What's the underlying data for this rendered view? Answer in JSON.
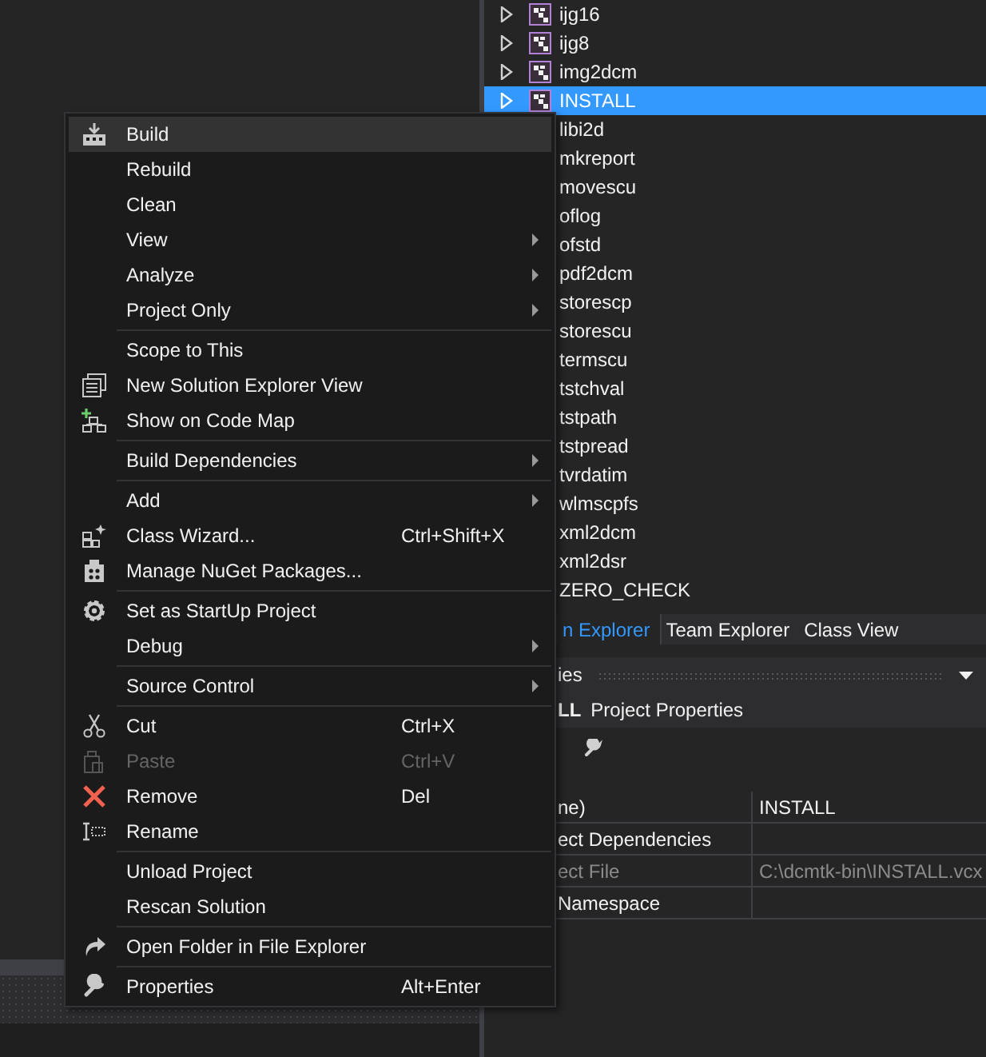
{
  "solution_explorer": {
    "items": [
      {
        "label": "ijg16",
        "selected": false
      },
      {
        "label": "ijg8",
        "selected": false
      },
      {
        "label": "img2dcm",
        "selected": false
      },
      {
        "label": "INSTALL",
        "selected": true
      },
      {
        "label": "libi2d",
        "selected": false
      },
      {
        "label": "mkreport",
        "selected": false
      },
      {
        "label": "movescu",
        "selected": false
      },
      {
        "label": "oflog",
        "selected": false
      },
      {
        "label": "ofstd",
        "selected": false
      },
      {
        "label": "pdf2dcm",
        "selected": false
      },
      {
        "label": "storescp",
        "selected": false
      },
      {
        "label": "storescu",
        "selected": false
      },
      {
        "label": "termscu",
        "selected": false
      },
      {
        "label": "tstchval",
        "selected": false
      },
      {
        "label": "tstpath",
        "selected": false
      },
      {
        "label": "tstpread",
        "selected": false
      },
      {
        "label": "tvrdatim",
        "selected": false
      },
      {
        "label": "wlmscpfs",
        "selected": false
      },
      {
        "label": "xml2dcm",
        "selected": false
      },
      {
        "label": "xml2dsr",
        "selected": false
      },
      {
        "label": "ZERO_CHECK",
        "selected": false
      }
    ]
  },
  "tabs": [
    {
      "label": "n Explorer",
      "selected": true
    },
    {
      "label": "Team Explorer",
      "selected": false
    },
    {
      "label": "Class View",
      "selected": false
    }
  ],
  "properties": {
    "title": "ies",
    "object": "LL",
    "object_type": "Project Properties",
    "rows": [
      {
        "name": "ne)",
        "value": "INSTALL",
        "disabled": false
      },
      {
        "name": "ect Dependencies",
        "disabled": false
      },
      {
        "name": "ect File",
        "value": "C:\\dcmtk-bin\\INSTALL.vcx",
        "disabled": true
      },
      {
        "name": "Namespace",
        "disabled": false
      }
    ]
  },
  "context_menu": {
    "items": [
      {
        "kind": "item",
        "label": "Build",
        "submenu": false,
        "disabled": false,
        "selected": true
      },
      {
        "kind": "item",
        "label": "Rebuild",
        "submenu": false,
        "disabled": false,
        "selected": false
      },
      {
        "kind": "item",
        "label": "Clean",
        "submenu": false,
        "disabled": false,
        "selected": false
      },
      {
        "kind": "item",
        "label": "View",
        "submenu": true,
        "disabled": false,
        "selected": false
      },
      {
        "kind": "item",
        "label": "Analyze",
        "submenu": true,
        "disabled": false,
        "selected": false
      },
      {
        "kind": "item",
        "label": "Project Only",
        "submenu": true,
        "disabled": false,
        "selected": false
      },
      {
        "kind": "separator"
      },
      {
        "kind": "item",
        "label": "Scope to This",
        "submenu": false,
        "disabled": false,
        "selected": false
      },
      {
        "kind": "item",
        "label": "New Solution Explorer View",
        "submenu": false,
        "disabled": false,
        "selected": false
      },
      {
        "kind": "item",
        "label": "Show on Code Map",
        "submenu": false,
        "disabled": false,
        "selected": false
      },
      {
        "kind": "separator"
      },
      {
        "kind": "item",
        "label": "Build Dependencies",
        "submenu": true,
        "disabled": false,
        "selected": false
      },
      {
        "kind": "separator"
      },
      {
        "kind": "item",
        "label": "Add",
        "submenu": true,
        "disabled": false,
        "selected": false
      },
      {
        "kind": "item",
        "label": "Class Wizard...",
        "shortcut": "Ctrl+Shift+X",
        "submenu": false,
        "disabled": false,
        "selected": false
      },
      {
        "kind": "item",
        "label": "Manage NuGet Packages...",
        "submenu": false,
        "disabled": false,
        "selected": false
      },
      {
        "kind": "separator"
      },
      {
        "kind": "item",
        "label": "Set as StartUp Project",
        "submenu": false,
        "disabled": false,
        "selected": false
      },
      {
        "kind": "item",
        "label": "Debug",
        "submenu": true,
        "disabled": false,
        "selected": false
      },
      {
        "kind": "separator"
      },
      {
        "kind": "item",
        "label": "Source Control",
        "submenu": true,
        "disabled": false,
        "selected": false
      },
      {
        "kind": "separator"
      },
      {
        "kind": "item",
        "label": "Cut",
        "shortcut": "Ctrl+X",
        "submenu": false,
        "disabled": false,
        "selected": false
      },
      {
        "kind": "item",
        "label": "Paste",
        "shortcut": "Ctrl+V",
        "submenu": false,
        "disabled": true,
        "selected": false
      },
      {
        "kind": "item",
        "label": "Remove",
        "shortcut": "Del",
        "submenu": false,
        "disabled": false,
        "selected": false
      },
      {
        "kind": "item",
        "label": "Rename",
        "submenu": false,
        "disabled": false,
        "selected": false
      },
      {
        "kind": "separator"
      },
      {
        "kind": "item",
        "label": "Unload Project",
        "submenu": false,
        "disabled": false,
        "selected": false
      },
      {
        "kind": "item",
        "label": "Rescan Solution",
        "submenu": false,
        "disabled": false,
        "selected": false
      },
      {
        "kind": "separator"
      },
      {
        "kind": "item",
        "label": "Open Folder in File Explorer",
        "submenu": false,
        "disabled": false,
        "selected": false
      },
      {
        "kind": "separator"
      },
      {
        "kind": "item",
        "label": "Properties",
        "shortcut": "Alt+Enter",
        "submenu": false,
        "disabled": false,
        "selected": false
      }
    ]
  }
}
